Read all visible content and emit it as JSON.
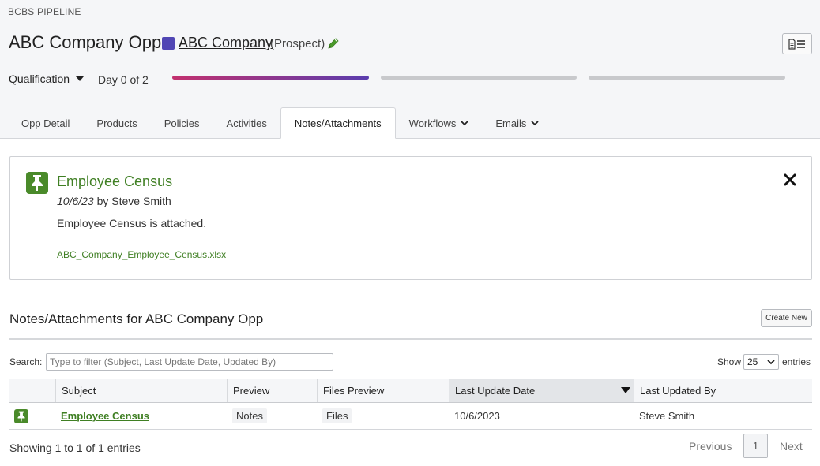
{
  "header": {
    "pipeline_label": "BCBS PIPELINE",
    "opp_title": "ABC Company Opp",
    "company_name": "ABC Company",
    "company_status": "(Prospect)",
    "company_color": "#5046b4"
  },
  "stage": {
    "label": "Qualification",
    "day_text": "Day 0 of 2",
    "progress_segments": [
      1,
      0,
      0
    ]
  },
  "tabs": [
    {
      "label": "Opp Detail"
    },
    {
      "label": "Products"
    },
    {
      "label": "Policies"
    },
    {
      "label": "Activities"
    },
    {
      "label": "Notes/Attachments"
    },
    {
      "label": "Workflows"
    },
    {
      "label": "Emails"
    }
  ],
  "note": {
    "title": "Employee Census",
    "date": "10/6/23",
    "by_text": "by Steve Smith",
    "body": "Employee Census is attached.",
    "file_name": "ABC_Company_Employee_Census.xlsx"
  },
  "section": {
    "title": "Notes/Attachments for ABC Company Opp",
    "create_label": "Create New"
  },
  "filters": {
    "search_label": "Search:",
    "search_placeholder": "Type to filter (Subject, Last Update Date, Updated By)",
    "show_label": "Show",
    "page_size": "25",
    "entries_label": "entries"
  },
  "table": {
    "columns": [
      "",
      "Subject",
      "Preview",
      "Files Preview",
      "Last Update Date",
      "Last Updated By"
    ],
    "rows": [
      {
        "subject": "Employee Census",
        "preview": "Notes",
        "files": "Files",
        "date": "10/6/2023",
        "updated_by": "Steve Smith"
      }
    ]
  },
  "pagination": {
    "summary": "Showing 1 to 1 of 1 entries",
    "previous": "Previous",
    "page": "1",
    "next": "Next"
  },
  "colors": {
    "accent_green": "#3f7f23",
    "progress_start": "#c2306e",
    "progress_end": "#5a3dae"
  }
}
